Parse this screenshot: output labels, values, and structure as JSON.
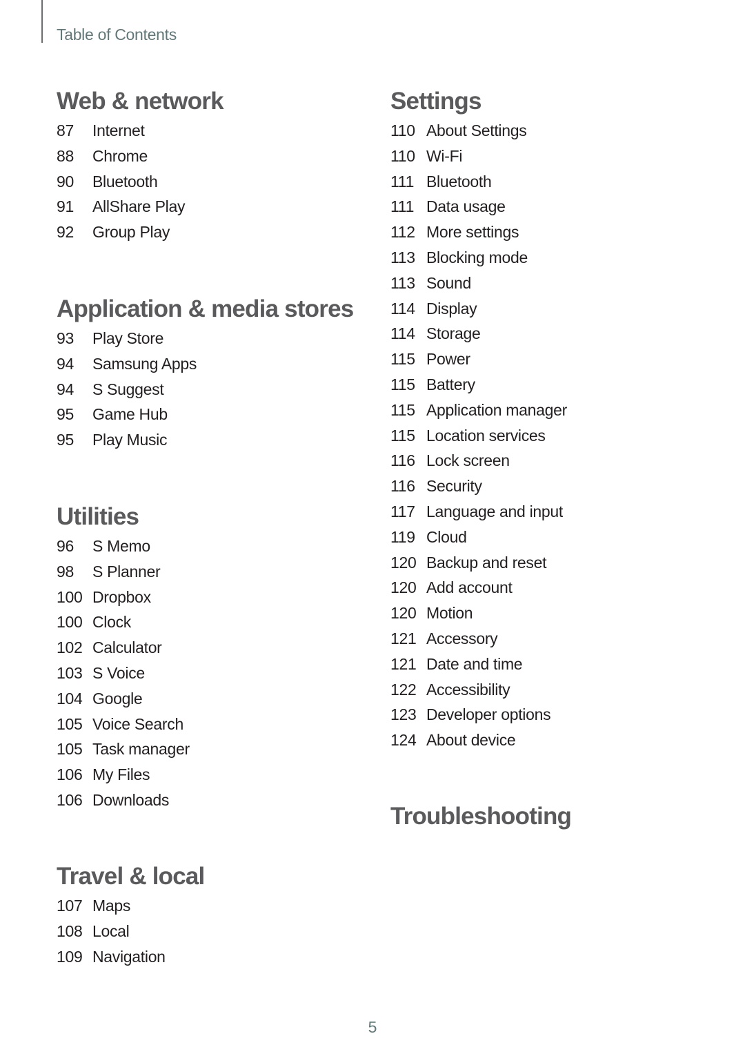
{
  "header": {
    "title": "Table of Contents"
  },
  "left_column": [
    {
      "title": "Web & network",
      "entries": [
        {
          "page": "87",
          "label": "Internet"
        },
        {
          "page": "88",
          "label": "Chrome"
        },
        {
          "page": "90",
          "label": "Bluetooth"
        },
        {
          "page": "91",
          "label": "AllShare Play"
        },
        {
          "page": "92",
          "label": "Group Play"
        }
      ]
    },
    {
      "title": "Application & media stores",
      "entries": [
        {
          "page": "93",
          "label": "Play Store"
        },
        {
          "page": "94",
          "label": "Samsung Apps"
        },
        {
          "page": "94",
          "label": "S Suggest"
        },
        {
          "page": "95",
          "label": "Game Hub"
        },
        {
          "page": "95",
          "label": "Play Music"
        }
      ]
    },
    {
      "title": "Utilities",
      "entries": [
        {
          "page": "96",
          "label": "S Memo"
        },
        {
          "page": "98",
          "label": "S Planner"
        },
        {
          "page": "100",
          "label": "Dropbox"
        },
        {
          "page": "100",
          "label": "Clock"
        },
        {
          "page": "102",
          "label": "Calculator"
        },
        {
          "page": "103",
          "label": "S Voice"
        },
        {
          "page": "104",
          "label": "Google"
        },
        {
          "page": "105",
          "label": "Voice Search"
        },
        {
          "page": "105",
          "label": "Task manager"
        },
        {
          "page": "106",
          "label": "My Files"
        },
        {
          "page": "106",
          "label": "Downloads"
        }
      ]
    },
    {
      "title": "Travel & local",
      "entries": [
        {
          "page": "107",
          "label": "Maps"
        },
        {
          "page": "108",
          "label": "Local"
        },
        {
          "page": "109",
          "label": "Navigation"
        }
      ]
    }
  ],
  "right_column": [
    {
      "title": "Settings",
      "entries": [
        {
          "page": "110",
          "label": "About Settings"
        },
        {
          "page": "110",
          "label": "Wi-Fi"
        },
        {
          "page": "111",
          "label": "Bluetooth"
        },
        {
          "page": "111",
          "label": "Data usage"
        },
        {
          "page": "112",
          "label": "More settings"
        },
        {
          "page": "113",
          "label": "Blocking mode"
        },
        {
          "page": "113",
          "label": "Sound"
        },
        {
          "page": "114",
          "label": "Display"
        },
        {
          "page": "114",
          "label": "Storage"
        },
        {
          "page": "115",
          "label": "Power"
        },
        {
          "page": "115",
          "label": "Battery"
        },
        {
          "page": "115",
          "label": "Application manager"
        },
        {
          "page": "115",
          "label": "Location services"
        },
        {
          "page": "116",
          "label": "Lock screen"
        },
        {
          "page": "116",
          "label": "Security"
        },
        {
          "page": "117",
          "label": "Language and input"
        },
        {
          "page": "119",
          "label": "Cloud"
        },
        {
          "page": "120",
          "label": "Backup and reset"
        },
        {
          "page": "120",
          "label": "Add account"
        },
        {
          "page": "120",
          "label": "Motion"
        },
        {
          "page": "121",
          "label": "Accessory"
        },
        {
          "page": "121",
          "label": "Date and time"
        },
        {
          "page": "122",
          "label": "Accessibility"
        },
        {
          "page": "123",
          "label": "Developer options"
        },
        {
          "page": "124",
          "label": "About device"
        }
      ]
    },
    {
      "title": "Troubleshooting",
      "entries": []
    }
  ],
  "footer": {
    "page_number": "5"
  }
}
